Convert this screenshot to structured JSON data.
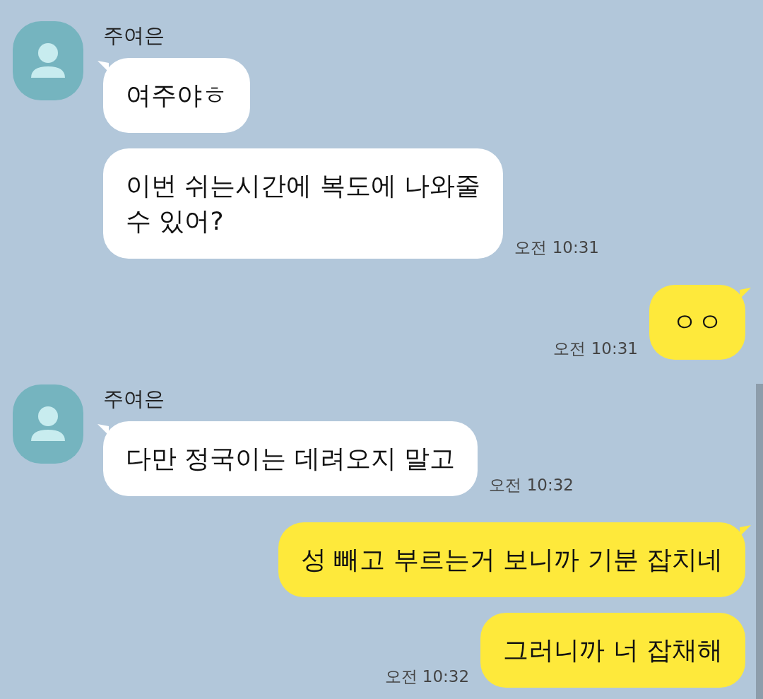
{
  "messages": [
    {
      "kind": "incoming",
      "sender": "주여은",
      "bubbles": [
        {
          "text": "여주야ㅎ"
        },
        {
          "text": "이번 쉬는시간에 복도에 나와줄\n수 있어?"
        }
      ],
      "time": "오전 10:31"
    },
    {
      "kind": "outgoing",
      "bubbles": [
        {
          "text": "ㅇㅇ"
        }
      ],
      "time": "오전 10:31"
    },
    {
      "kind": "incoming",
      "sender": "주여은",
      "bubbles": [
        {
          "text": "다만 정국이는 데려오지 말고"
        }
      ],
      "time": "오전 10:32"
    },
    {
      "kind": "outgoing",
      "bubbles": [
        {
          "text": "성 빼고 부르는거 보니까 기분 잡치네"
        },
        {
          "text": "그러니까 너 잡채해"
        }
      ],
      "time": "오전 10:32"
    }
  ]
}
